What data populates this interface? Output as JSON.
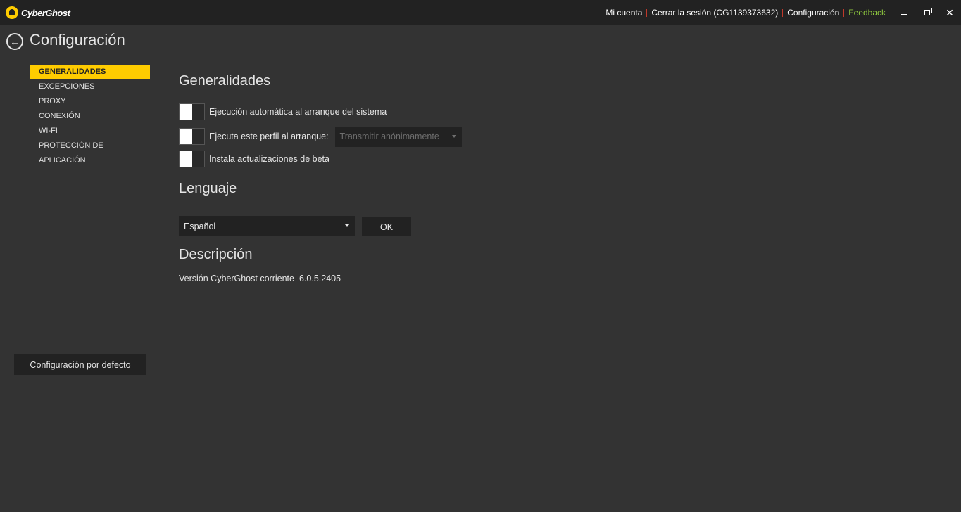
{
  "app": {
    "logo_text": "CyberGhost"
  },
  "topnav": {
    "account": "Mi cuenta",
    "logout": "Cerrar la sesión (CG1139373632)",
    "settings": "Configuración",
    "feedback": "Feedback",
    "feedback_color": "#8dc63f"
  },
  "window_controls": {
    "close_glyph": "✕"
  },
  "header": {
    "back_glyph": "←",
    "title": "Configuración"
  },
  "sidebar": {
    "items": [
      {
        "label": "GENERALIDADES",
        "active": true
      },
      {
        "label": "EXCEPCIONES",
        "active": false
      },
      {
        "label": "PROXY",
        "active": false
      },
      {
        "label": "CONEXIÓN",
        "active": false
      },
      {
        "label": "WI-FI",
        "active": false
      },
      {
        "label": "PROTECCIÓN DE APLICACIÓN",
        "active": false
      }
    ],
    "default_button": "Configuración por defecto",
    "accent_color": "#ffcc00"
  },
  "general": {
    "title": "Generalidades",
    "options": [
      {
        "label": "Ejecución automática al arranque del sistema",
        "enabled": false
      },
      {
        "label": "Ejecuta este perfil al arranque:",
        "enabled": false
      },
      {
        "label": "Instala actualizaciones de beta",
        "enabled": false
      }
    ],
    "profile_select": {
      "value": "Transmitir anónimamente",
      "disabled": true
    }
  },
  "language": {
    "title": "Lenguaje",
    "selected": "Español",
    "ok_label": "OK"
  },
  "description": {
    "title": "Descripción",
    "version_label": "Versión CyberGhost corriente",
    "version_value": "6.0.5.2405"
  }
}
